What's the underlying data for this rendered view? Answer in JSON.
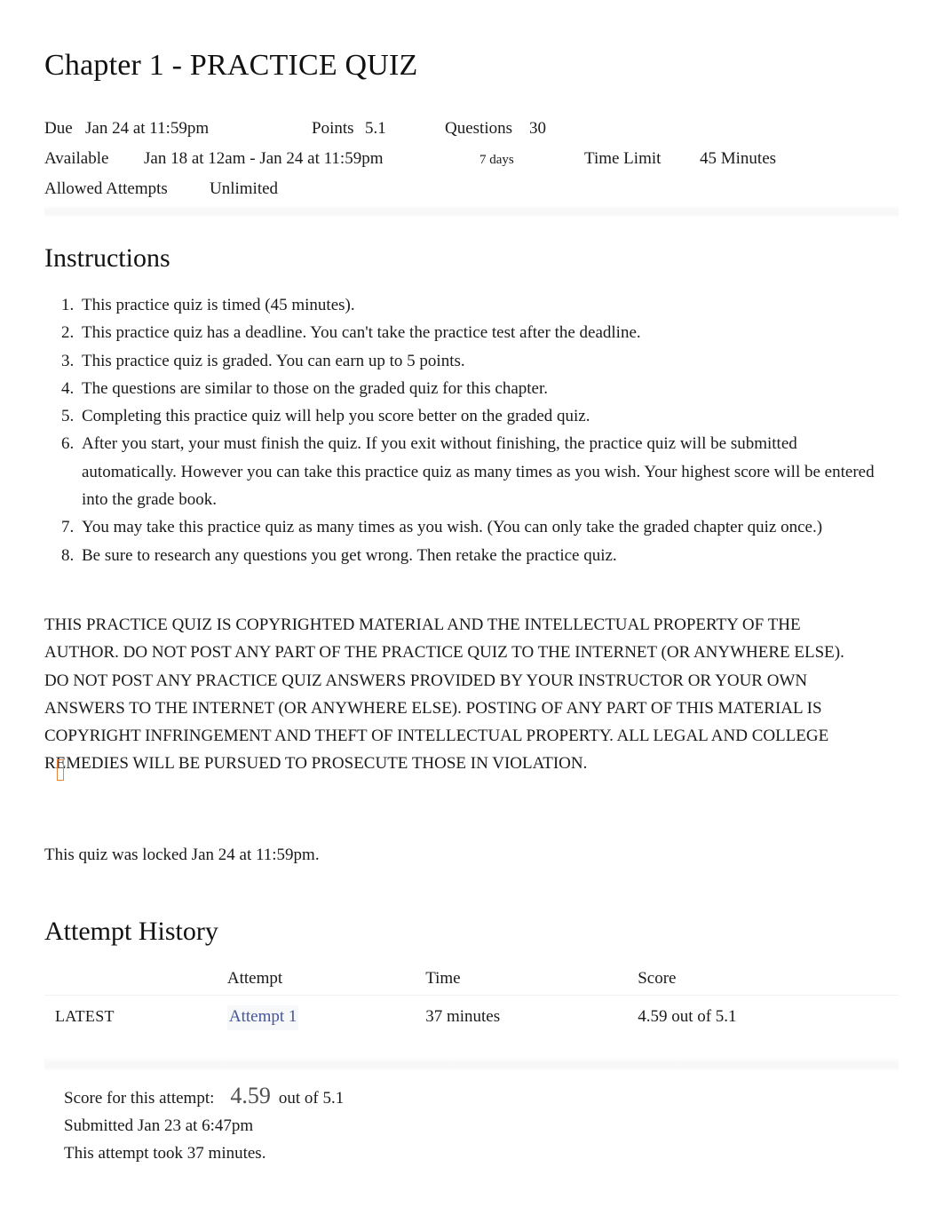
{
  "quiz": {
    "title": "Chapter 1 - PRACTICE QUIZ"
  },
  "meta": {
    "due_label": "Due",
    "due_value": "Jan 24 at 11:59pm",
    "points_label": "Points",
    "points_value": "5.1",
    "questions_label": "Questions",
    "questions_value": "30",
    "available_label": "Available",
    "available_value": "Jan 18 at 12am - Jan 24 at 11:59pm",
    "available_duration": "7 days",
    "time_limit_label": "Time Limit",
    "time_limit_value": "45 Minutes",
    "allowed_attempts_label": "Allowed Attempts",
    "allowed_attempts_value": "Unlimited"
  },
  "instructions": {
    "heading": "Instructions",
    "items": [
      "This practice quiz is timed (45 minutes).",
      "This practice quiz has a deadline. You can't take the practice test after the deadline.",
      "This practice quiz is graded. You can earn up to 5 points.",
      "The questions are similar to those on the graded quiz for this chapter.",
      "Completing this practice quiz will help you score better on the graded quiz.",
      "After you start, your must finish the quiz. If you exit without finishing, the practice quiz will be submitted automatically. However you can take this practice quiz as many times as you wish. Your highest score will be entered into the grade book.",
      "You may take this practice quiz as many times as you wish. (You can only take the graded chapter quiz once.)",
      "Be sure to research any questions you get wrong. Then retake the practice quiz."
    ],
    "copyright_notice": "THIS PRACTICE QUIZ IS COPYRIGHTED MATERIAL AND THE INTELLECTUAL PROPERTY OF THE AUTHOR. DO NOT POST ANY PART OF THE PRACTICE QUIZ TO THE INTERNET (OR ANYWHERE ELSE). DO NOT POST ANY PRACTICE QUIZ ANSWERS PROVIDED BY YOUR INSTRUCTOR OR YOUR OWN ANSWERS TO THE INTERNET (OR ANYWHERE ELSE). POSTING OF ANY PART OF THIS MATERIAL IS COPYRIGHT INFRINGEMENT AND THEFT OF INTELLECTUAL PROPERTY. ALL LEGAL AND COLLEGE REMEDIES WILL BE PURSUED TO PROSECUTE THOSE IN VIOLATION."
  },
  "locked_notice": "This quiz was locked Jan 24 at 11:59pm.",
  "attempt_history": {
    "heading": "Attempt History",
    "columns": [
      "",
      "Attempt",
      "Time",
      "Score"
    ],
    "rows": [
      {
        "kept": "LATEST",
        "attempt": "Attempt 1",
        "time": "37 minutes",
        "score": "4.59 out of 5.1"
      }
    ]
  },
  "score_summary": {
    "score_label": "Score for this attempt:",
    "score_value": "4.59",
    "score_out_of": "out of 5.1",
    "submitted": "Submitted Jan 23 at 6:47pm",
    "duration": "This attempt took 37 minutes."
  },
  "colors": {
    "link": "#45559a",
    "score_value": "#4e4e4e",
    "cursor_artifact": "#e8833a",
    "text": "#1a1a1a",
    "divider": "#f7f7f8"
  }
}
